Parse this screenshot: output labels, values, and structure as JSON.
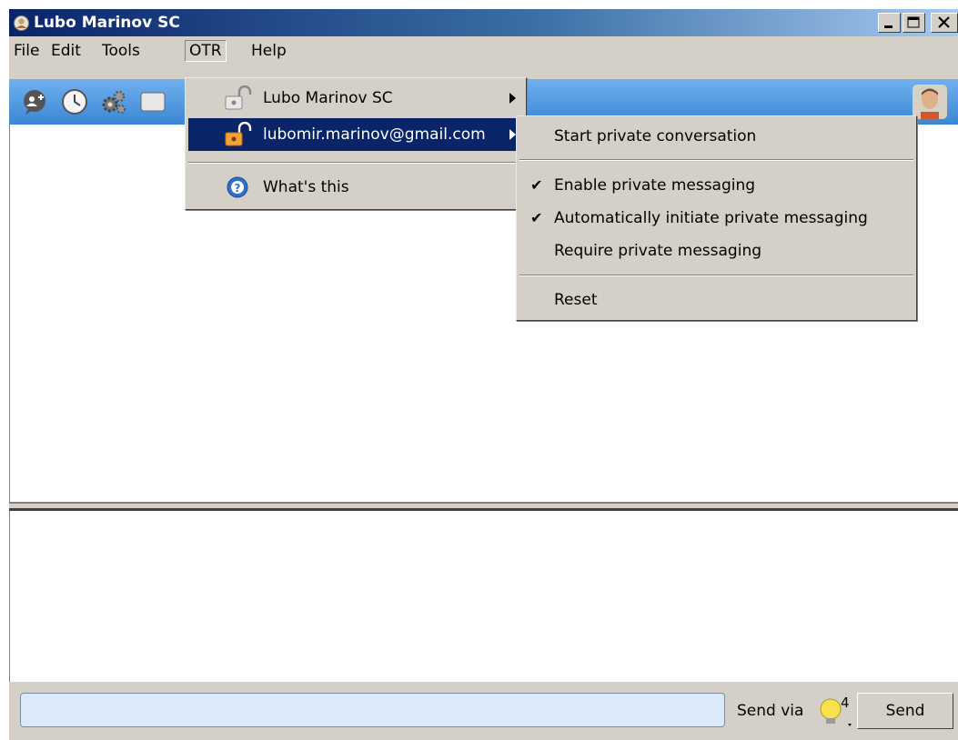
{
  "window": {
    "title": "Lubo Marinov SC",
    "buttons": [
      "minimize",
      "maximize",
      "close"
    ]
  },
  "menubar": {
    "items": [
      "File",
      "Edit",
      "Tools",
      "OTR",
      "Help"
    ],
    "active": "OTR"
  },
  "toolbar": {
    "icons": [
      "add-contact-icon",
      "history-clock-icon",
      "plugins-gears-icon",
      "info-icon"
    ],
    "avatar": "contact-avatar"
  },
  "otr_menu": {
    "items": [
      {
        "label": "Lubo Marinov SC",
        "icon": "lock-open-gray-icon",
        "submenu": true
      },
      {
        "label": "lubomir.marinov@gmail.com",
        "icon": "lock-open-orange-icon",
        "submenu": true,
        "highlighted": true
      },
      {
        "label": "What's this",
        "icon": "help-icon"
      }
    ]
  },
  "submenu": {
    "items": [
      {
        "label": "Start private conversation",
        "checked": false
      },
      {
        "label": "Enable private messaging",
        "checked": true
      },
      {
        "label": "Automatically initiate private messaging",
        "checked": true
      },
      {
        "label": "Require private messaging",
        "checked": false
      },
      {
        "label": "Reset",
        "checked": false
      }
    ],
    "check_mark": "✔"
  },
  "compose": {
    "input_value": "",
    "send_via_label": "Send via",
    "protocol_badge": "4",
    "send_label": "Send"
  },
  "colors": {
    "highlight": "#0a246a",
    "menu_bg": "#d4d0c8",
    "toolbar": "#4a93dc",
    "input_bg": "#dce9f8"
  }
}
